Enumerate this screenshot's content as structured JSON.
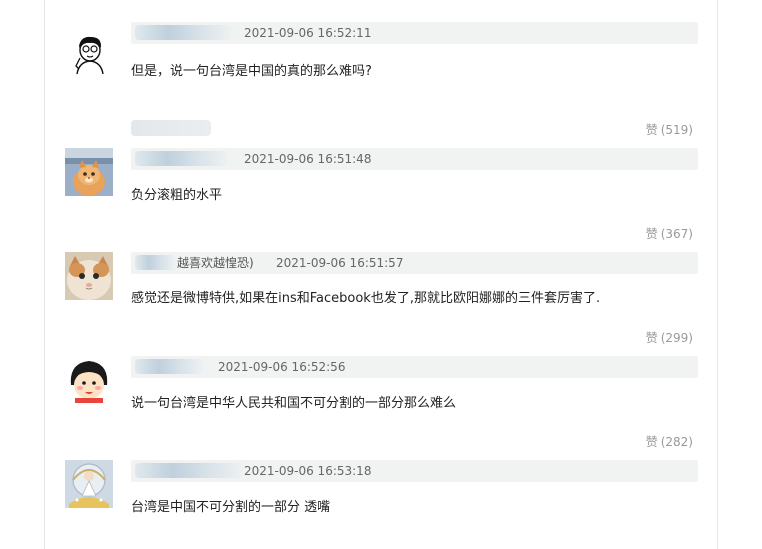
{
  "comments": [
    {
      "timestamp": "2021-09-06 16:52:11",
      "body": "但是，说一句台湾是中国的真的那么难吗?",
      "likes_label": "赞",
      "likes_count": "(519)",
      "avatar": "stick-figure-cartoon"
    },
    {
      "timestamp": "2021-09-06 16:51:48",
      "body": "负分滚粗的水平",
      "likes_label": "赞",
      "likes_count": "(367)",
      "avatar": "orange-cat-photo"
    },
    {
      "handle_suffix": "越喜欢越惶恐)",
      "timestamp": "2021-09-06 16:51:57",
      "body": "感觉还是微博特供,如果在ins和Facebook也发了,那就比欧阳娜娜的三件套厉害了.",
      "likes_label": "赞",
      "likes_count": "(299)",
      "avatar": "fluffy-cat-photo"
    },
    {
      "timestamp": "2021-09-06 16:52:56",
      "body": "说一句台湾是中华人民共和国不可分割的一部分那么难么",
      "likes_label": "赞",
      "likes_count": "(282)",
      "avatar": "maruko-cartoon"
    },
    {
      "timestamp": "2021-09-06 16:53:18",
      "body": "台湾是中国不可分割的一部分 透嘴",
      "avatar": "figure-on-ornament"
    }
  ]
}
